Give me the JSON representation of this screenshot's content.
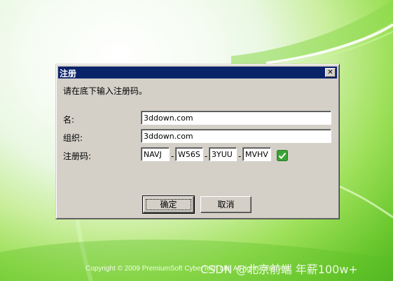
{
  "background": {
    "copyright": "Copyright © 2009 PremiumSoft CyberTech Ltd. All rights reserved.",
    "watermark": "CSDN @北京前端 年薪100w+"
  },
  "dialog": {
    "title": "注册",
    "instruction": "请在底下输入注册码。",
    "fields": {
      "name_label": "名:",
      "name_value": "3ddown.com",
      "org_label": "组织:",
      "org_value": "3ddown.com",
      "code_label": "注册码:",
      "code_parts": [
        "NAVJ",
        "W56S",
        "3YUU",
        "MVHV"
      ],
      "separator": "-"
    },
    "buttons": {
      "ok": "确定",
      "cancel": "取消"
    }
  },
  "colors": {
    "titlebar": "#0a246a",
    "dialog_face": "#d4d0c8",
    "check_green": "#3aa335"
  },
  "icons": {
    "close": "close-icon",
    "valid": "check-icon"
  }
}
